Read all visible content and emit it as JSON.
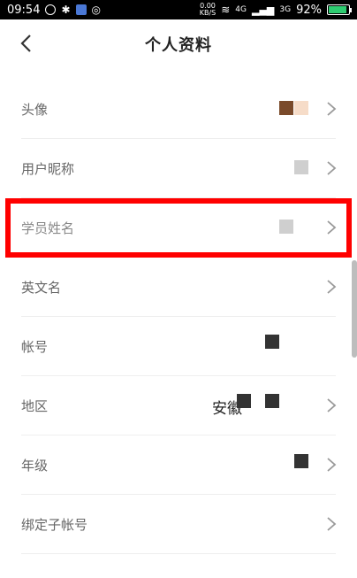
{
  "status_bar": {
    "time": "09:54",
    "network_speed_value": "0.00",
    "network_speed_unit": "KB/S",
    "signal_1": "4G",
    "signal_2": "3G",
    "battery_percent": "92%",
    "battery_fraction": 0.92,
    "icons": [
      "alarm-icon",
      "bluetooth-icon",
      "app-icon",
      "qq-icon",
      "wifi-icon",
      "signal-icon",
      "battery-icon"
    ]
  },
  "header": {
    "back_icon": "chevron-left-icon",
    "title": "个人资料"
  },
  "rows": [
    {
      "label": "头像"
    },
    {
      "label": "用户昵称"
    },
    {
      "label": "学员姓名"
    },
    {
      "label": "英文名"
    },
    {
      "label": "帐号"
    },
    {
      "label": "地区",
      "value_text": "安徽"
    },
    {
      "label": "年级"
    },
    {
      "label": "绑定子帐号"
    }
  ],
  "colors": {
    "highlight": "#ff0000",
    "label": "#666666",
    "chevron": "#999999"
  }
}
